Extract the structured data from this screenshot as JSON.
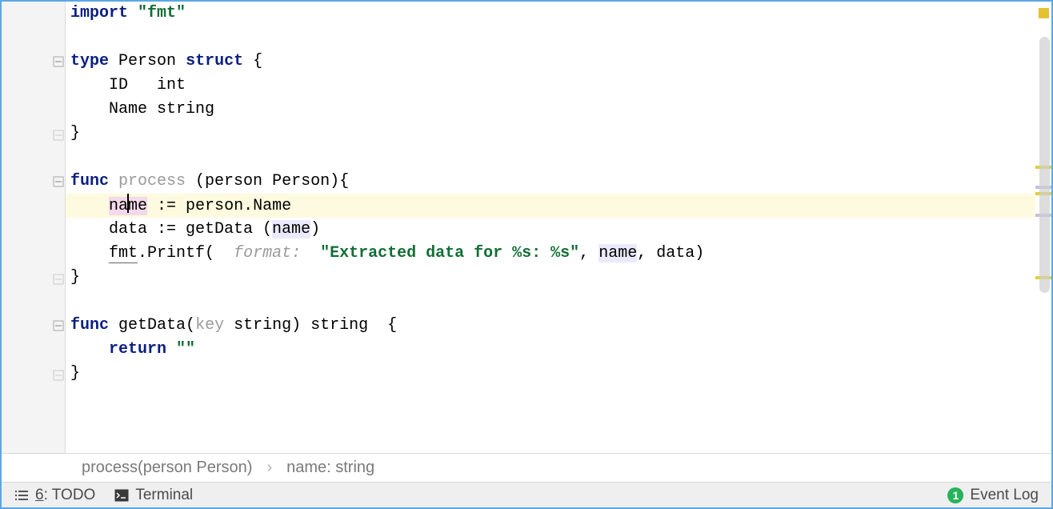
{
  "code": {
    "import_kw": "import",
    "import_pkg": "\"fmt\"",
    "type_kw": "type",
    "type_name": "Person",
    "struct_kw": "struct",
    "struct_open": "{",
    "field_id": "    ID   int",
    "field_name": "    Name string",
    "struct_close": "}",
    "func_kw": "func",
    "process_name": "process",
    "process_sig_open": " (person Person){",
    "assign_name_pre": "    ",
    "assign_name_a": "na",
    "assign_name_b": "me",
    "assign_name_rest": " := person.Name",
    "assign_data_pre": "    data := getData (",
    "assign_data_arg": "name",
    "assign_data_post": ")",
    "printf_indent": "    ",
    "printf_pkg": "fmt",
    "printf_call": ".Printf( ",
    "printf_hint": " format: ",
    "printf_str": "\"Extracted data for %s: %s\"",
    "printf_sep1": ", ",
    "printf_arg1": "name",
    "printf_sep2": ", data)",
    "process_close": "}",
    "getdata_name": "getData",
    "getdata_sig_a": "(",
    "getdata_key": "key",
    "getdata_sig_b": " string) string  {",
    "return_kw": "return",
    "return_val": "\"\"",
    "getdata_close": "}"
  },
  "breadcrumbs": {
    "item1": "process(person Person)",
    "item2": "name: string"
  },
  "status": {
    "todo_num": "6",
    "todo_label": ": TODO",
    "terminal": "Terminal",
    "event_count": "1",
    "event_label": "Event Log"
  }
}
